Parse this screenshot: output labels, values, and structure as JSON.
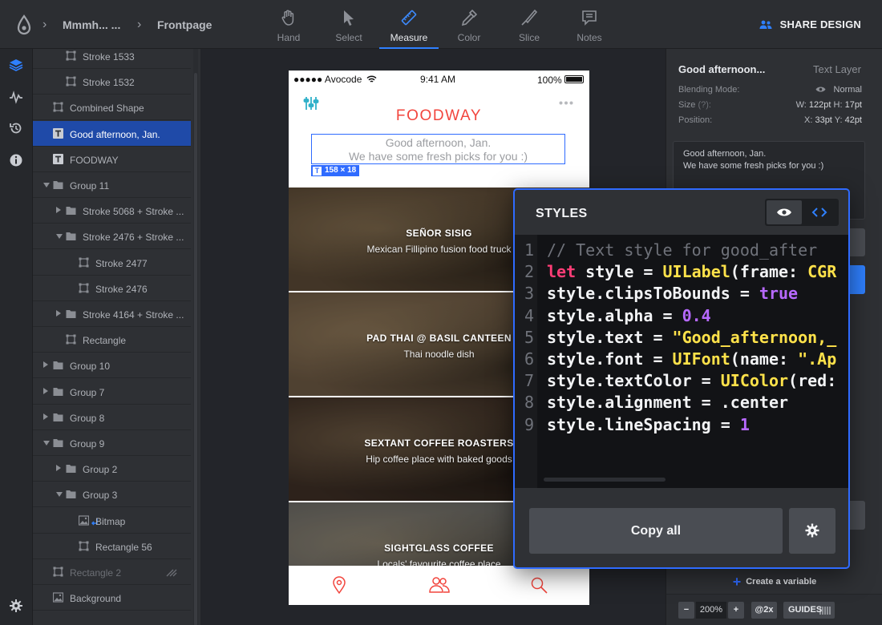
{
  "header": {
    "breadcrumb": [
      "Mmmh... ...",
      "Frontpage"
    ],
    "tools": [
      {
        "label": "Hand",
        "icon": "hand-icon",
        "active": false
      },
      {
        "label": "Select",
        "icon": "cursor-icon",
        "active": false
      },
      {
        "label": "Measure",
        "icon": "ruler-icon",
        "active": true
      },
      {
        "label": "Color",
        "icon": "eyedropper-icon",
        "active": false
      },
      {
        "label": "Slice",
        "icon": "knife-icon",
        "active": false
      },
      {
        "label": "Notes",
        "icon": "note-icon",
        "active": false
      }
    ],
    "share_label": "SHARE DESIGN"
  },
  "layers": [
    {
      "label": "Stroke 1533",
      "type": "shape",
      "indent": 2,
      "caret": "none"
    },
    {
      "label": "Stroke 1532",
      "type": "shape",
      "indent": 2,
      "caret": "none"
    },
    {
      "label": "Combined Shape",
      "type": "shape",
      "indent": 1,
      "caret": "none"
    },
    {
      "label": "Good afternoon, Jan.",
      "type": "text",
      "indent": 1,
      "caret": "none",
      "selected": true
    },
    {
      "label": "FOODWAY",
      "type": "text",
      "indent": 1,
      "caret": "none"
    },
    {
      "label": "Group 11",
      "type": "folder",
      "indent": 1,
      "caret": "down"
    },
    {
      "label": "Stroke 5068 + Stroke ...",
      "type": "folder",
      "indent": 2,
      "caret": "right"
    },
    {
      "label": "Stroke 2476 + Stroke ...",
      "type": "folder",
      "indent": 2,
      "caret": "down"
    },
    {
      "label": "Stroke 2477",
      "type": "shape",
      "indent": 3,
      "caret": "none"
    },
    {
      "label": "Stroke 2476",
      "type": "shape",
      "indent": 3,
      "caret": "none"
    },
    {
      "label": "Stroke 4164 + Stroke ...",
      "type": "folder",
      "indent": 2,
      "caret": "right"
    },
    {
      "label": "Rectangle",
      "type": "shape",
      "indent": 2,
      "caret": "none"
    },
    {
      "label": "Group 10",
      "type": "folder",
      "indent": 1,
      "caret": "right"
    },
    {
      "label": "Group 7",
      "type": "folder",
      "indent": 1,
      "caret": "right"
    },
    {
      "label": "Group 8",
      "type": "folder",
      "indent": 1,
      "caret": "right"
    },
    {
      "label": "Group 9",
      "type": "folder",
      "indent": 1,
      "caret": "down"
    },
    {
      "label": "Group 2",
      "type": "folder",
      "indent": 2,
      "caret": "right"
    },
    {
      "label": "Group 3",
      "type": "folder",
      "indent": 2,
      "caret": "down"
    },
    {
      "label": "Bitmap",
      "type": "image",
      "indent": 3,
      "caret": "none",
      "mask": true
    },
    {
      "label": "Rectangle 56",
      "type": "shape",
      "indent": 3,
      "caret": "none"
    },
    {
      "label": "Rectangle 2",
      "type": "shape",
      "indent": 1,
      "caret": "none",
      "dim": true,
      "hidden_icon": true
    },
    {
      "label": "Background",
      "type": "image",
      "indent": 1,
      "caret": "none"
    }
  ],
  "phone": {
    "carrier": "●●●●● Avocode",
    "time": "9:41 AM",
    "battery": "100%",
    "brand": "FOODWAY",
    "greeting_line1": "Good afternoon, Jan.",
    "greeting_line2": "We have some fresh picks for you :)",
    "badge": "158 × 18",
    "cards": [
      {
        "name": "SEÑOR SISIG",
        "desc": "Mexican Fillipino fusion food truck",
        "bg": "#5c4a36"
      },
      {
        "name": "PAD THAI @ BASIL CANTEEN",
        "desc": "Thai noodle dish",
        "bg": "#6e5a44"
      },
      {
        "name": "SEXTANT COFFEE ROASTERS",
        "desc": "Hip coffee place with baked goods",
        "bg": "#3f3026"
      },
      {
        "name": "SIGHTGLASS COFFEE",
        "desc": "Locals' favourite coffee place",
        "bg": "#6b6a66"
      }
    ]
  },
  "inspector": {
    "title": "Good afternoon...",
    "type": "Text Layer",
    "blending_label": "Blending Mode:",
    "blending_value": "Normal",
    "size_label": "Size",
    "size_hint": "(?):",
    "size_w": "122pt",
    "size_h": "17pt",
    "position_label": "Position:",
    "pos_x": "33pt",
    "pos_y": "42pt",
    "text_line1": "Good afternoon, Jan.",
    "text_line2": "We have some fresh picks for you :)",
    "create_variable": "Create a variable",
    "zoom": "200%",
    "at2x": "@2x",
    "guides": "GUIDES"
  },
  "styles_popover": {
    "title": "STYLES",
    "line_numbers": [
      "1",
      "2",
      "3",
      "4",
      "5",
      "6",
      "7",
      "8",
      "9"
    ],
    "copy_all": "Copy all"
  },
  "colors": {
    "accent": "#2f6bff",
    "brand_red": "#f2453d",
    "selection": "#1f4aa8"
  }
}
